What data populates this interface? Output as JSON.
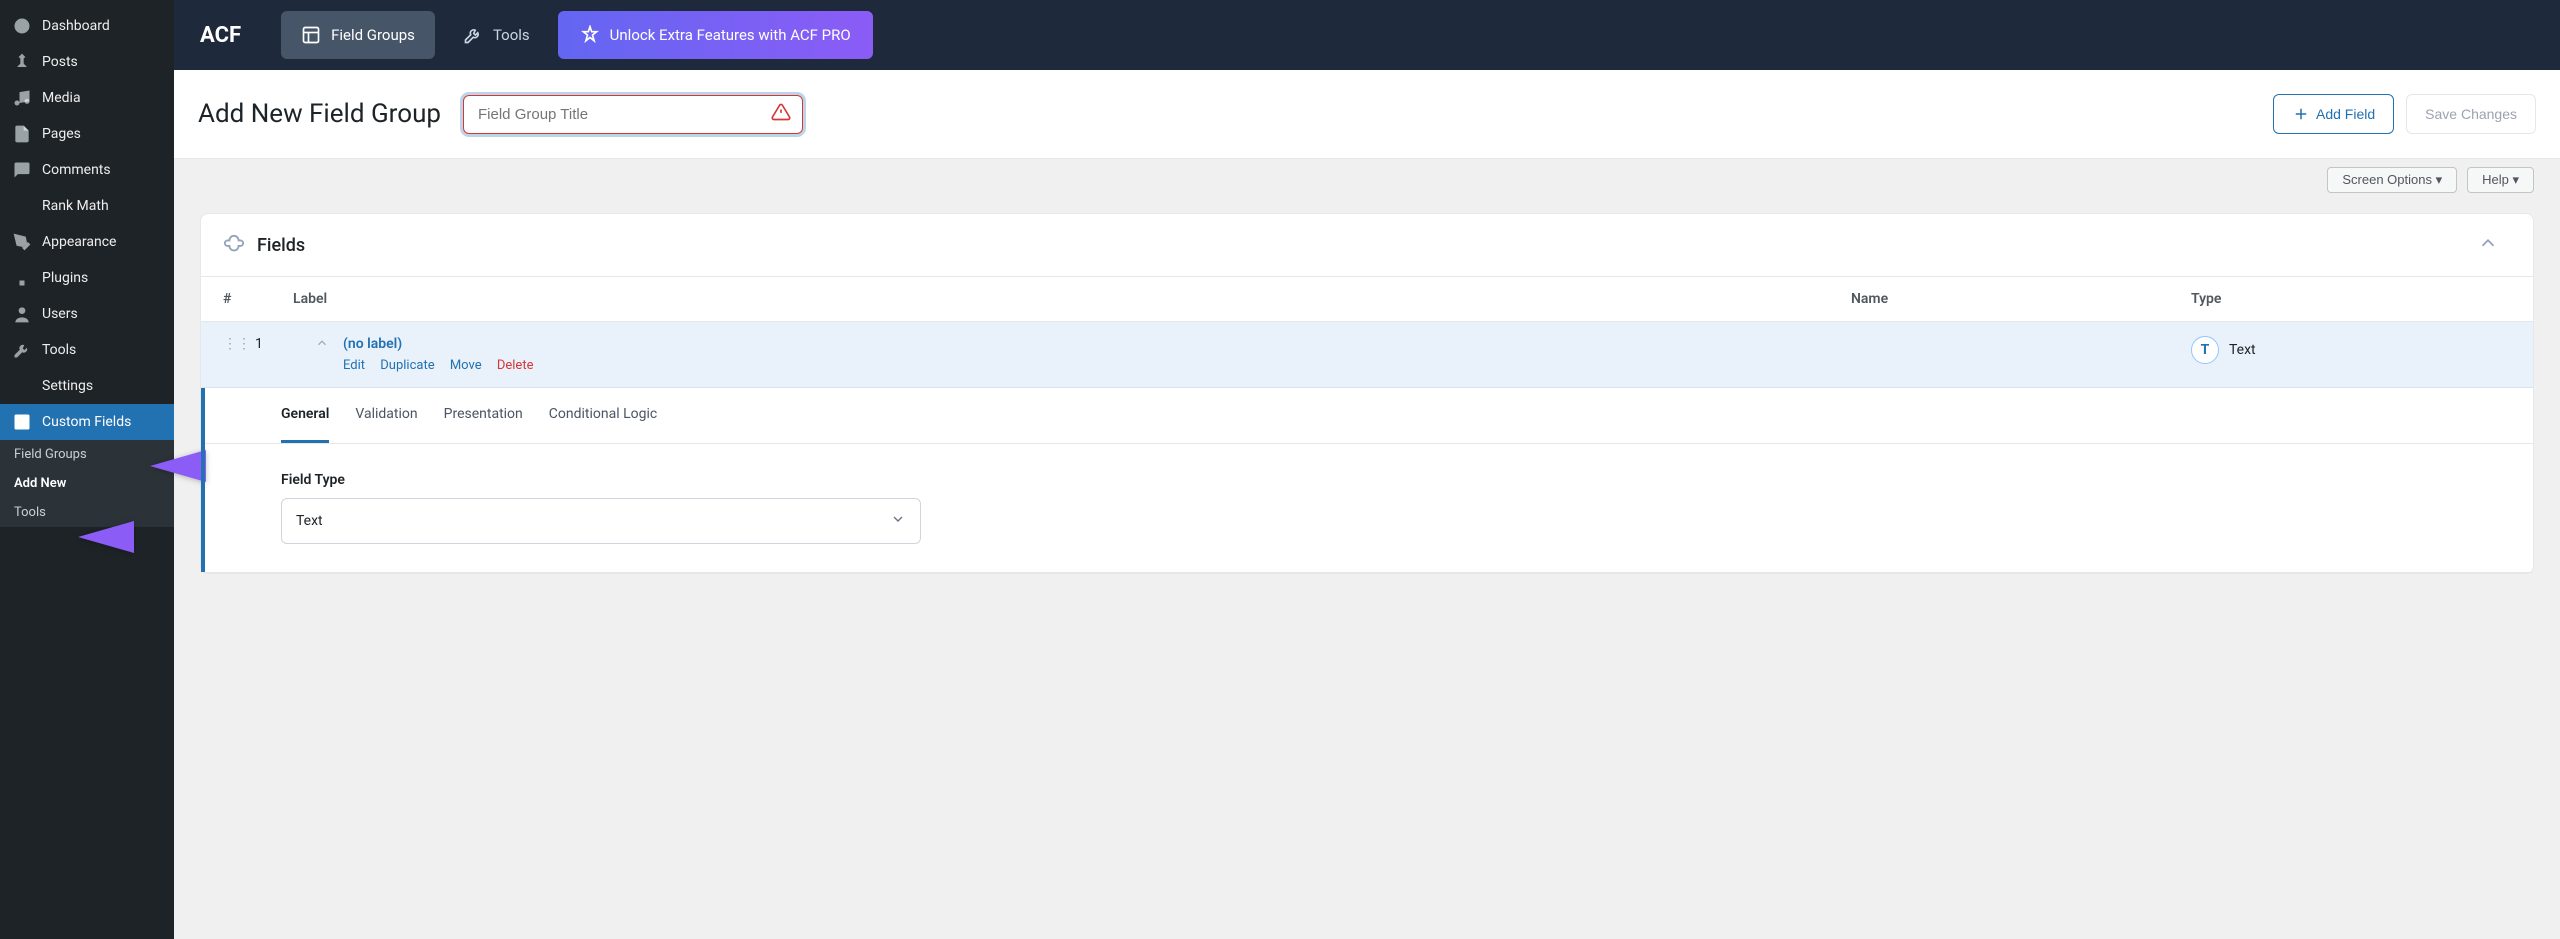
{
  "sidebar": [
    {
      "icon": "dashboard",
      "label": "Dashboard"
    },
    {
      "icon": "pin",
      "label": "Posts"
    },
    {
      "icon": "media",
      "label": "Media"
    },
    {
      "icon": "page",
      "label": "Pages"
    },
    {
      "icon": "comment",
      "label": "Comments"
    },
    {
      "icon": "chart",
      "label": "Rank Math"
    },
    {
      "icon": "brush",
      "label": "Appearance"
    },
    {
      "icon": "plugin",
      "label": "Plugins"
    },
    {
      "icon": "user",
      "label": "Users"
    },
    {
      "icon": "wrench",
      "label": "Tools"
    },
    {
      "icon": "settings",
      "label": "Settings"
    },
    {
      "icon": "layout",
      "label": "Custom Fields",
      "active": true
    }
  ],
  "sidebar_sub": [
    {
      "label": "Field Groups"
    },
    {
      "label": "Add New",
      "current": true
    },
    {
      "label": "Tools"
    }
  ],
  "topbar": {
    "logo": "ACF",
    "tabs": [
      {
        "label": "Field Groups",
        "active": true
      },
      {
        "label": "Tools"
      }
    ],
    "upgrade": "Unlock Extra Features with ACF PRO"
  },
  "header": {
    "title": "Add New Field Group",
    "placeholder": "Field Group Title",
    "add_field": "Add Field",
    "save": "Save Changes"
  },
  "screen": {
    "options": "Screen Options",
    "help": "Help"
  },
  "panel": {
    "title": "Fields"
  },
  "cols": {
    "num": "#",
    "label": "Label",
    "name": "Name",
    "type": "Type"
  },
  "row": {
    "num": "1",
    "label": "(no label)",
    "actions": {
      "edit": "Edit",
      "duplicate": "Duplicate",
      "move": "Move",
      "delete": "Delete"
    },
    "type": "Text",
    "type_badge": "T"
  },
  "tabs": [
    "General",
    "Validation",
    "Presentation",
    "Conditional Logic"
  ],
  "field_type": {
    "label": "Field Type",
    "value": "Text"
  }
}
